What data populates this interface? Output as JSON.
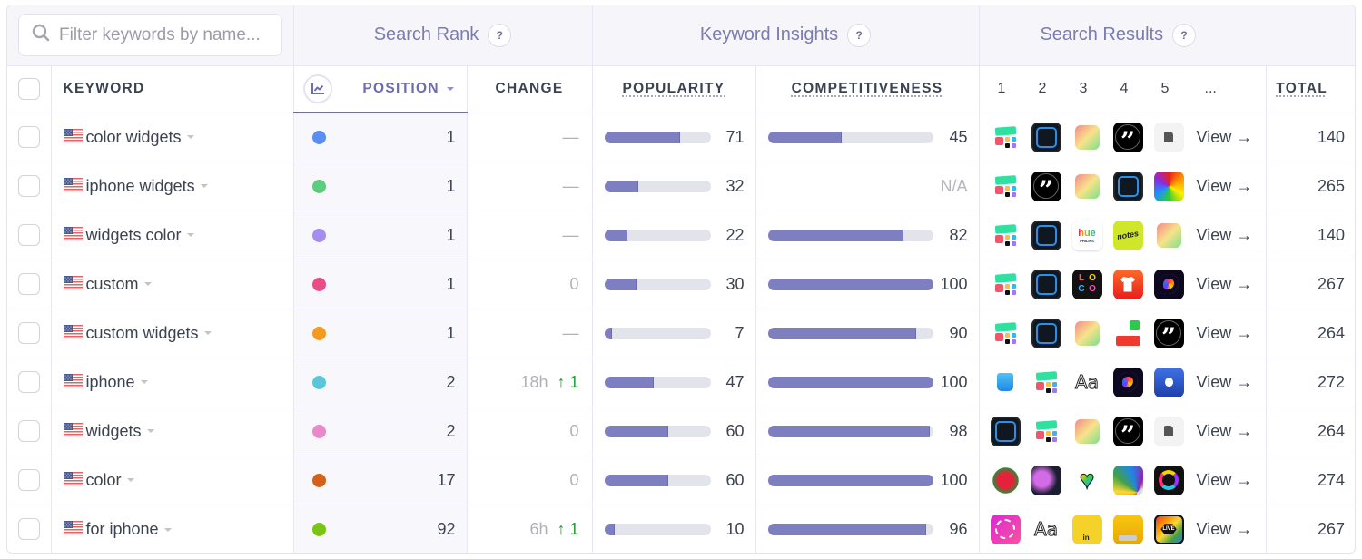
{
  "filter": {
    "placeholder": "Filter keywords by name..."
  },
  "groups": {
    "search_rank": "Search Rank",
    "keyword_insights": "Keyword Insights",
    "search_results": "Search Results",
    "help_label": "?"
  },
  "columns": {
    "keyword": "KEYWORD",
    "position": "POSITION",
    "change": "CHANGE",
    "popularity": "POPULARITY",
    "competitiveness": "COMPETITIVENESS",
    "result_ranks": [
      "1",
      "2",
      "3",
      "4",
      "5",
      "..."
    ],
    "total": "TOTAL"
  },
  "view_label": "View →",
  "colors": {
    "accent": "#6b6cb2",
    "bar_fill": "#7e7fc1",
    "bar_track": "#e3e3ec",
    "change_up": "#23a23a"
  },
  "rows": [
    {
      "keyword": "color widgets",
      "country": "us-flag",
      "dot_color": "#5b8ef0",
      "position": "1",
      "change": {
        "text": "—",
        "time": "",
        "up": ""
      },
      "popularity": 71,
      "popularity_label": "71",
      "competitiveness": 45,
      "competitiveness_label": "45",
      "apps": [
        "color-widgets-app-icon",
        "square-widget-app-icon",
        "gradient-app-icon",
        "quote-app-icon",
        "dino-app-icon"
      ],
      "total": "140"
    },
    {
      "keyword": "iphone widgets",
      "country": "us-flag",
      "dot_color": "#5ecb7e",
      "position": "1",
      "change": {
        "text": "—",
        "time": "",
        "up": ""
      },
      "popularity": 32,
      "popularity_label": "32",
      "competitiveness": null,
      "competitiveness_label": "N/A",
      "apps": [
        "color-widgets-app-icon",
        "quote-app-icon",
        "gradient-app-icon",
        "square-widget-app-icon",
        "rainbow-swirl-app-icon"
      ],
      "total": "265"
    },
    {
      "keyword": "widgets color",
      "country": "us-flag",
      "dot_color": "#a58ef0",
      "position": "1",
      "change": {
        "text": "—",
        "time": "",
        "up": ""
      },
      "popularity": 22,
      "popularity_label": "22",
      "competitiveness": 82,
      "competitiveness_label": "82",
      "apps": [
        "color-widgets-app-icon",
        "square-widget-app-icon",
        "hue-app-icon",
        "notes-app-icon",
        "gradient-app-icon"
      ],
      "total": "140"
    },
    {
      "keyword": "custom",
      "country": "us-flag",
      "dot_color": "#ea4c86",
      "position": "1",
      "change": {
        "text": "0",
        "time": "",
        "up": ""
      },
      "popularity": 30,
      "popularity_label": "30",
      "competitiveness": 100,
      "competitiveness_label": "100",
      "apps": [
        "color-widgets-app-icon",
        "square-widget-app-icon",
        "loco-app-icon",
        "tshirt-app-icon",
        "neon-blob-app-icon"
      ],
      "total": "267"
    },
    {
      "keyword": "custom widgets",
      "country": "us-flag",
      "dot_color": "#f59a1f",
      "position": "1",
      "change": {
        "text": "—",
        "time": "",
        "up": ""
      },
      "popularity": 7,
      "popularity_label": "7",
      "competitiveness": 90,
      "competitiveness_label": "90",
      "apps": [
        "color-widgets-app-icon",
        "square-widget-app-icon",
        "gradient-app-icon",
        "blocks-app-icon",
        "quote-app-icon"
      ],
      "total": "264"
    },
    {
      "keyword": "iphone",
      "country": "us-flag",
      "dot_color": "#5cc6d8",
      "position": "2",
      "change": {
        "text": "",
        "time": "18h",
        "up": "↑ 1"
      },
      "popularity": 47,
      "popularity_label": "47",
      "competitiveness": 100,
      "competitiveness_label": "100",
      "apps": [
        "app-store-icon",
        "color-widgets-app-icon",
        "fonts-aa-app-icon",
        "neon-blob-app-icon",
        "apple-support-app-icon"
      ],
      "total": "272"
    },
    {
      "keyword": "widgets",
      "country": "us-flag",
      "dot_color": "#e889c9",
      "position": "2",
      "change": {
        "text": "0",
        "time": "",
        "up": ""
      },
      "popularity": 60,
      "popularity_label": "60",
      "competitiveness": 98,
      "competitiveness_label": "98",
      "apps": [
        "square-widget-app-icon",
        "color-widgets-app-icon",
        "gradient-app-icon",
        "quote-app-icon",
        "dino-app-icon"
      ],
      "total": "264"
    },
    {
      "keyword": "color",
      "country": "us-flag",
      "dot_color": "#d1621c",
      "position": "17",
      "change": {
        "text": "0",
        "time": "",
        "up": ""
      },
      "popularity": 60,
      "popularity_label": "60",
      "competitiveness": 100,
      "competitiveness_label": "100",
      "apps": [
        "rose-coloring-app-icon",
        "flowers-coloring-app-icon",
        "pixel-heart-app-icon",
        "pencils-app-icon",
        "color-ring-game-icon"
      ],
      "total": "274"
    },
    {
      "keyword": "for iphone",
      "country": "us-flag",
      "dot_color": "#7ac511",
      "position": "92",
      "change": {
        "text": "",
        "time": "6h",
        "up": "↑ 1"
      },
      "popularity": 10,
      "popularity_label": "10",
      "competitiveness": 96,
      "competitiveness_label": "96",
      "apps": [
        "photo-app-icon",
        "fonts-aa-app-icon",
        "tape-measure-app-icon",
        "ruler-app-icon",
        "live-wallpaper-app-icon"
      ],
      "total": "267"
    }
  ]
}
